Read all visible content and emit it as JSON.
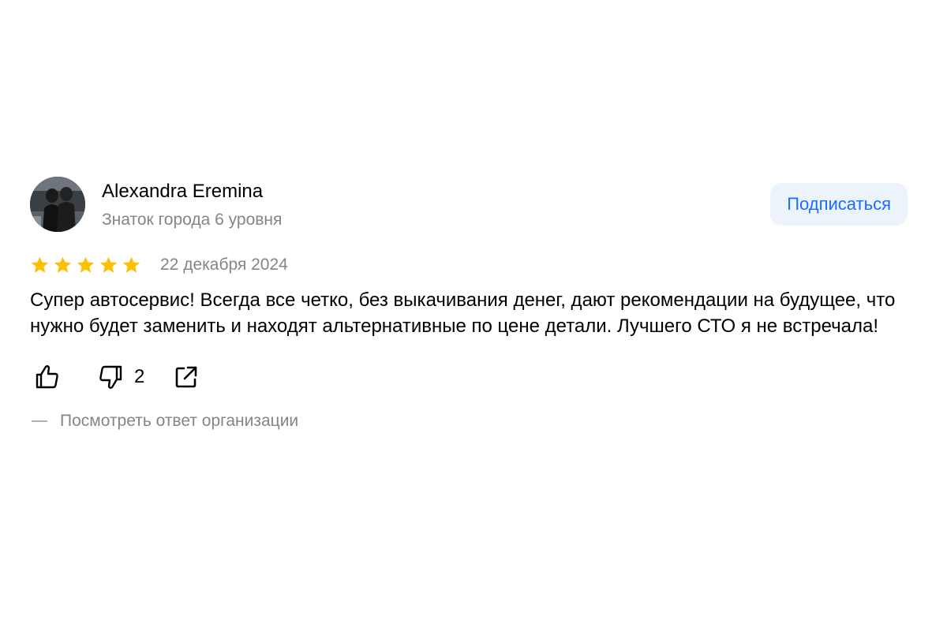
{
  "author": {
    "name": "Alexandra Eremina",
    "level": "Знаток города 6 уровня",
    "avatar": "avatar-photo"
  },
  "subscribe_button": {
    "label": "Подписаться"
  },
  "review": {
    "rating": 5,
    "rating_max": 5,
    "date": "22 декабря 2024",
    "text": "Супер автосервис! Всегда все четко, без выкачивания денег, дают рекомендации на будущее, что нужно будет заменить и находят альтернативные по цене детали. Лучшего СТО я не встречала!"
  },
  "actions": {
    "like_icon": "thumbs-up-icon",
    "dislike_icon": "thumbs-down-icon",
    "dislike_count": "2",
    "share_icon": "share-icon"
  },
  "org_reply": {
    "label": "Посмотреть ответ организации"
  },
  "colors": {
    "star": "#fcc000",
    "accent": "#196dff",
    "button_bg": "#edf3fb",
    "secondary_text": "#858585"
  }
}
